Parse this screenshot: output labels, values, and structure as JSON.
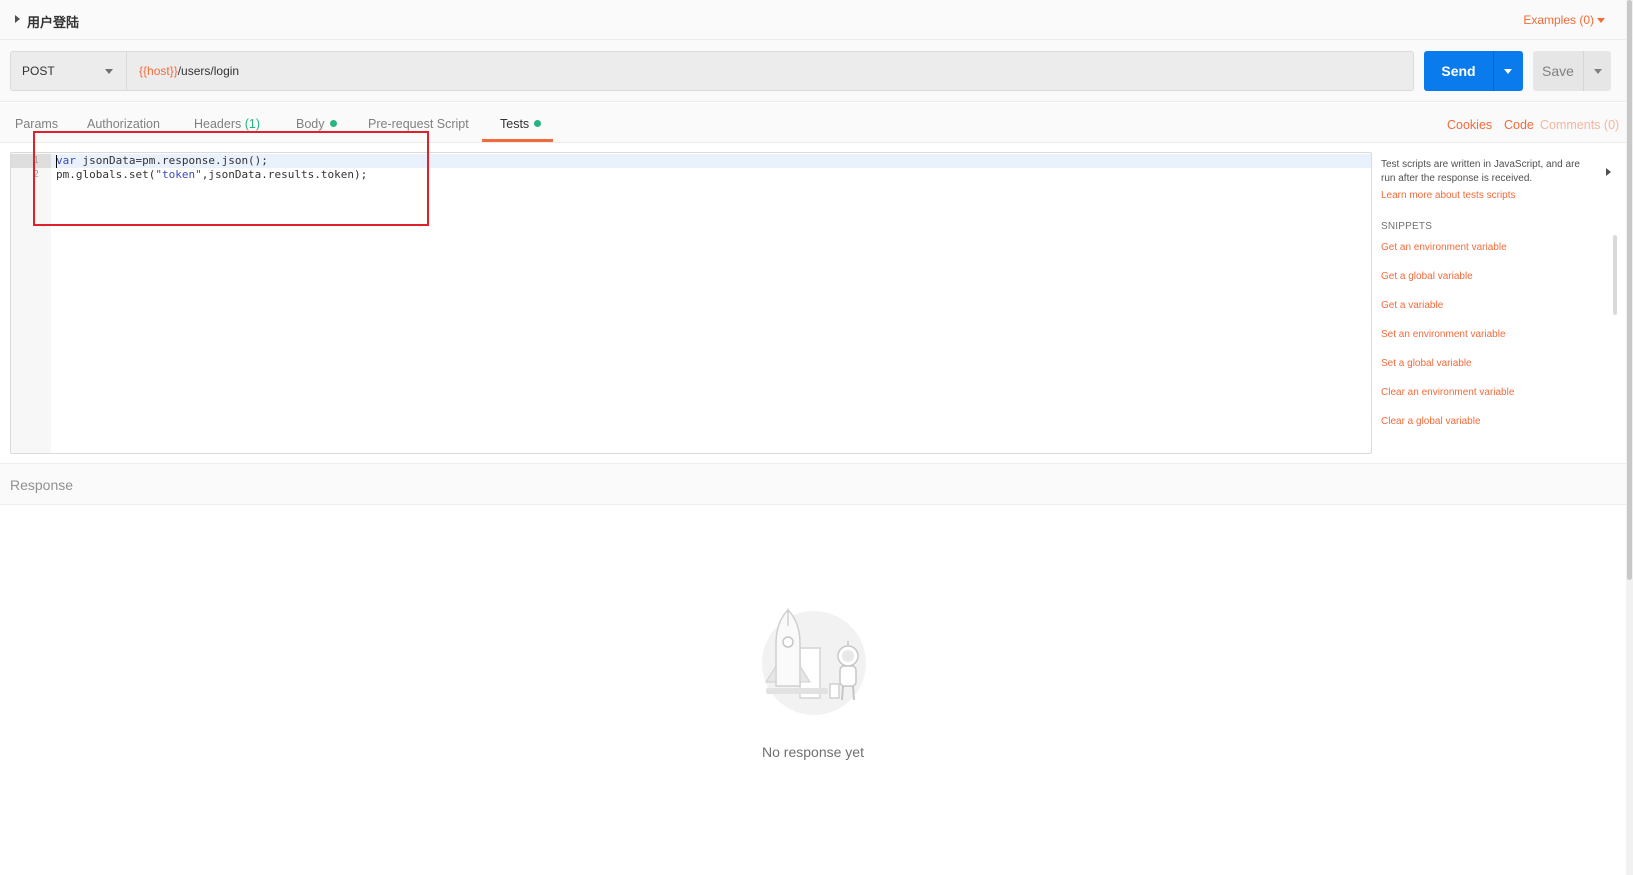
{
  "request": {
    "title": "用户登陆",
    "examples_label": "Examples (0)"
  },
  "url_bar": {
    "method": "POST",
    "url_variable": "{{host}}",
    "url_path": "/users/login",
    "send_label": "Send",
    "save_label": "Save"
  },
  "tabs": [
    {
      "label": "Params"
    },
    {
      "label": "Authorization"
    },
    {
      "label": "Headers",
      "count": "(1)"
    },
    {
      "label": "Body"
    },
    {
      "label": "Pre-request Script"
    },
    {
      "label": "Tests"
    }
  ],
  "active_tab": "Tests",
  "right_links": {
    "cookies": "Cookies",
    "code": "Code",
    "comments": "Comments (0)"
  },
  "editor": {
    "line_numbers": [
      "1",
      "2"
    ],
    "lines": [
      {
        "kw": "var",
        "rest": " jsonData=pm.response.json();"
      },
      {
        "pre": "pm.globals.set(",
        "str": "\"token\"",
        "post": ",jsonData.results.token);"
      }
    ]
  },
  "side_panel": {
    "description": "Test scripts are written in JavaScript, and are run after the response is received.",
    "learn_more": "Learn more about tests scripts",
    "snippets_heading": "SNIPPETS",
    "snippets": [
      "Get an environment variable",
      "Get a global variable",
      "Get a variable",
      "Set an environment variable",
      "Set a global variable",
      "Clear an environment variable",
      "Clear a global variable"
    ]
  },
  "response": {
    "label": "Response",
    "empty_message": "No response yet"
  },
  "colors": {
    "accent": "#f26b3a",
    "send_blue": "#097bed",
    "status_green": "#26b47f",
    "highlight_red": "#e0212a"
  },
  "icons": [
    "caret-right-icon",
    "chevron-down-icon",
    "status-dot-icon",
    "rocket-astronaut-illustration"
  ]
}
